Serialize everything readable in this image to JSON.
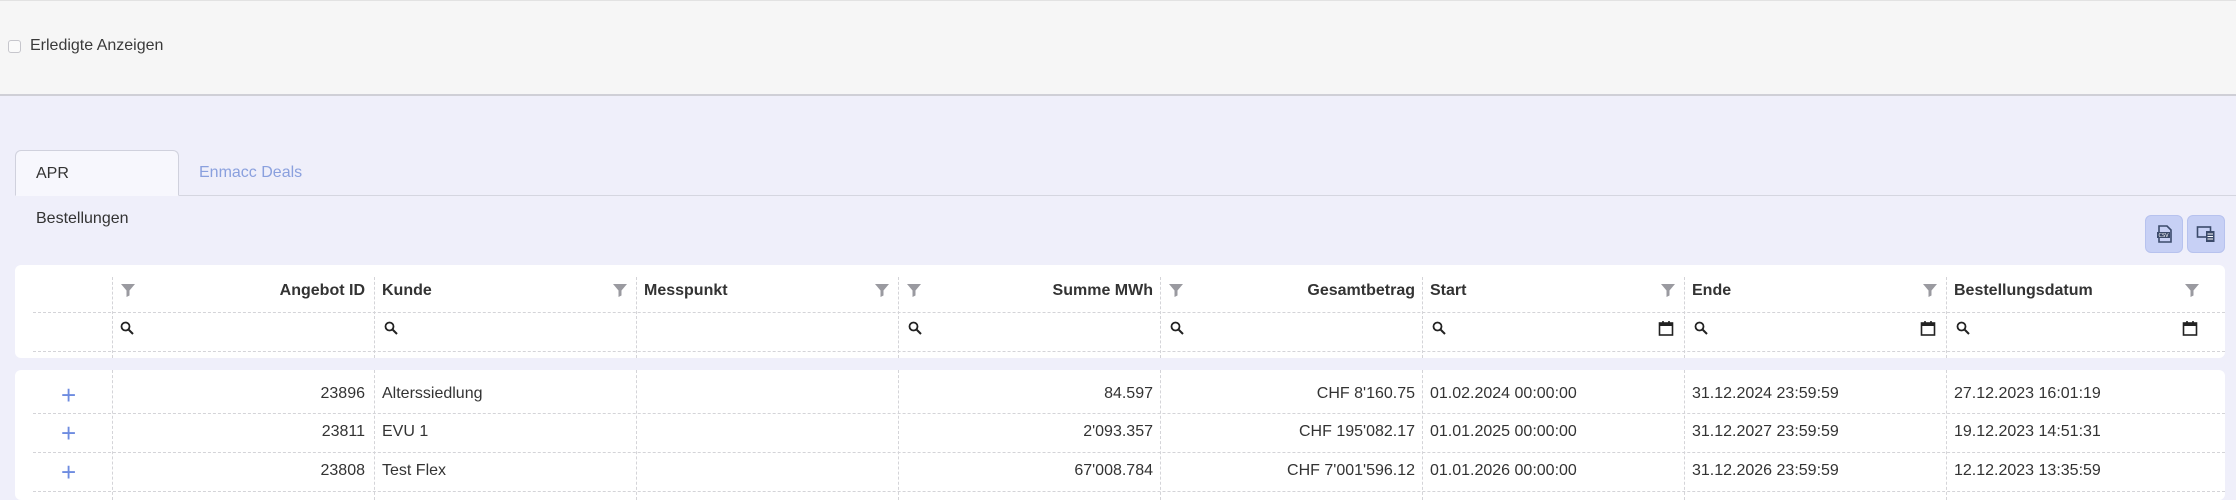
{
  "filter": {
    "show_done_label": "Erledigte Anzeigen",
    "checked": false
  },
  "tabs": [
    {
      "label": "APR Bestellungen",
      "active": true
    },
    {
      "label": "Enmacc Deals",
      "active": false
    }
  ],
  "toolbar": {
    "csv_icon": "csv-export-icon",
    "columns_icon": "column-chooser-icon"
  },
  "table": {
    "columns": [
      "Angebot ID",
      "Kunde",
      "Messpunkt",
      "Summe MWh",
      "Gesamtbetrag",
      "Start",
      "Ende",
      "Bestellungsdatum"
    ],
    "rows": [
      {
        "id": "23896",
        "kunde": "Alterssiedlung",
        "messpunkt": "",
        "summe": "84.597",
        "gesamt": "CHF 8'160.75",
        "start": "01.02.2024 00:00:00",
        "ende": "31.12.2024 23:59:59",
        "bestellt": "27.12.2023 16:01:19"
      },
      {
        "id": "23811",
        "kunde": "EVU 1",
        "messpunkt": "",
        "summe": "2'093.357",
        "gesamt": "CHF 195'082.17",
        "start": "01.01.2025 00:00:00",
        "ende": "31.12.2027 23:59:59",
        "bestellt": "19.12.2023 14:51:31"
      },
      {
        "id": "23808",
        "kunde": "Test Flex",
        "messpunkt": "",
        "summe": "67'008.784",
        "gesamt": "CHF 7'001'596.12",
        "start": "01.01.2026 00:00:00",
        "ende": "31.12.2026 23:59:59",
        "bestellt": "12.12.2023 13:35:59"
      }
    ]
  },
  "colors": {
    "accent": "#6e8ce0",
    "tab_inactive": "#8aa0de",
    "button_bg": "#c7d0f5",
    "page_bg": "#efeffa"
  }
}
